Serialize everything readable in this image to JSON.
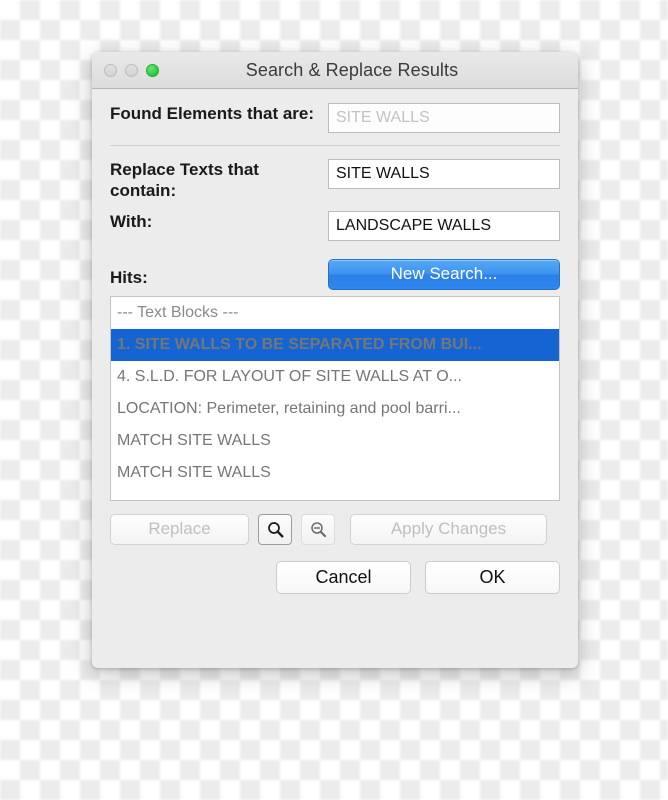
{
  "window": {
    "title": "Search & Replace Results",
    "traffic_lights": [
      {
        "name": "close",
        "state": "inactive",
        "color": "#d8d8d8"
      },
      {
        "name": "minimize",
        "state": "inactive",
        "color": "#d8d8d8"
      },
      {
        "name": "zoom",
        "state": "active",
        "color": "#27c93f"
      }
    ]
  },
  "fields": {
    "found_elements": {
      "label": "Found Elements that are:",
      "value": "",
      "placeholder": "SITE WALLS",
      "disabled": true
    },
    "replace_texts": {
      "label": "Replace Texts that contain:",
      "value": "SITE WALLS",
      "placeholder": ""
    },
    "with": {
      "label": "With:",
      "value": "LANDSCAPE WALLS",
      "placeholder": ""
    }
  },
  "buttons": {
    "new_search": "New Search...",
    "replace": "Replace",
    "apply_changes": "Apply Changes",
    "cancel": "Cancel",
    "ok": "OK"
  },
  "hits": {
    "label": "Hits:",
    "rows": [
      {
        "text": "---  Text Blocks  ---",
        "type": "header",
        "selected": false
      },
      {
        "text": "1. SITE WALLS TO BE SEPARATED FROM BUI...",
        "type": "item",
        "selected": true
      },
      {
        "text": "4.  S.L.D. FOR LAYOUT OF SITE WALLS AT O...",
        "type": "item",
        "selected": false
      },
      {
        "text": "LOCATION: Perimeter, retaining and pool barri...",
        "type": "item",
        "selected": false
      },
      {
        "text": "MATCH SITE WALLS",
        "type": "item",
        "selected": false
      },
      {
        "text": "MATCH SITE WALLS",
        "type": "item",
        "selected": false
      }
    ]
  },
  "icons": {
    "zoom_in": "magnifier-icon",
    "zoom_out": "magnifier-minus-icon"
  },
  "colors": {
    "accent_blue": "#2f86ec",
    "selection_blue": "#1464d4",
    "window_bg": "#ececec",
    "titlebar_bg": "#dcdcdc",
    "green_light": "#27c93f",
    "disabled_text": "#bfbfbf"
  }
}
